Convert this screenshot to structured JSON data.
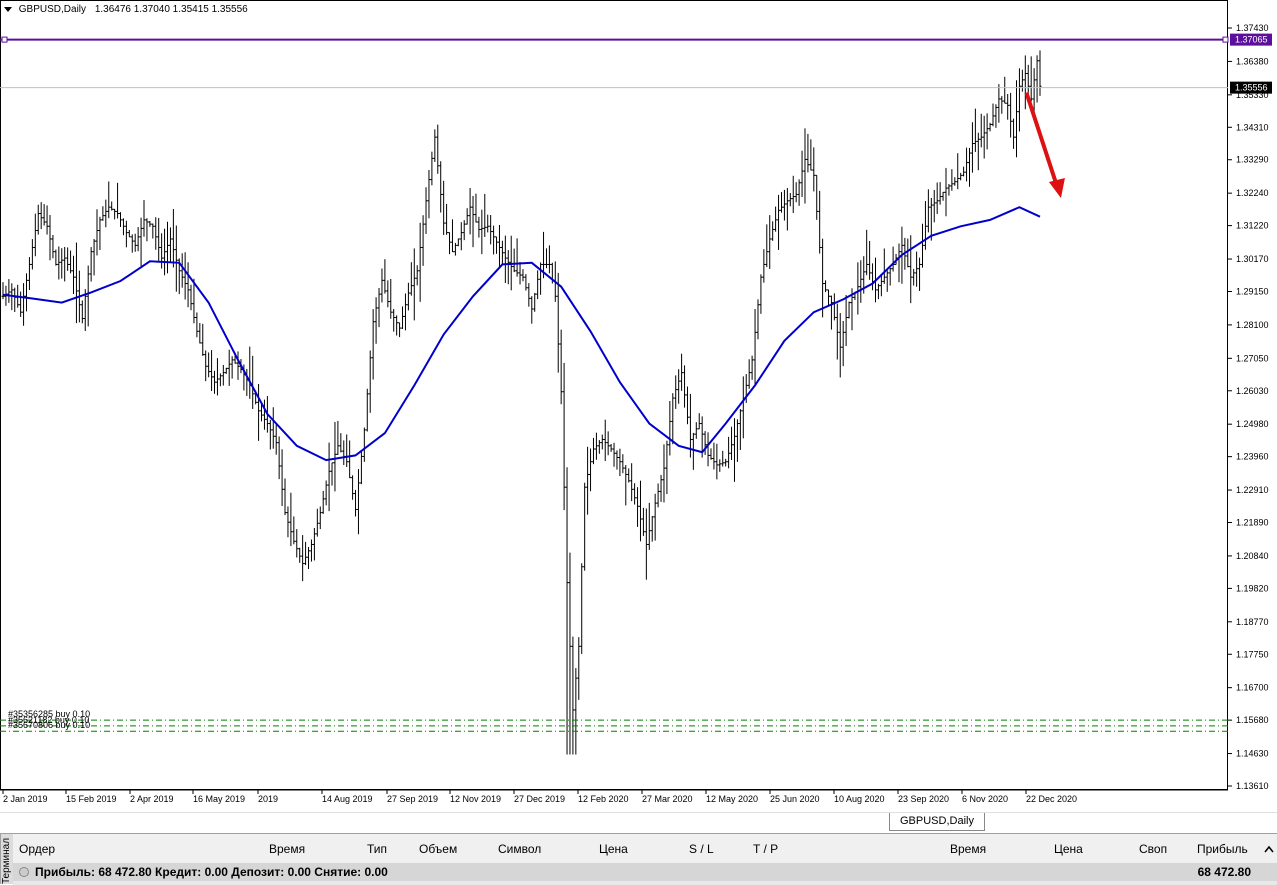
{
  "window": {
    "symbol_label": "GBPUSD,Daily",
    "ohlc": "1.36476 1.37040 1.35415 1.35556"
  },
  "chart_data": {
    "type": "candlestick",
    "symbol": "GBPUSD",
    "timeframe": "Daily",
    "ylim": [
      1.1361,
      1.3774
    ],
    "y_ticks": [
      "1.37430",
      "1.36380",
      "1.35330",
      "1.34310",
      "1.33290",
      "1.32240",
      "1.31220",
      "1.30170",
      "1.29150",
      "1.28100",
      "1.27050",
      "1.26030",
      "1.24980",
      "1.23960",
      "1.22910",
      "1.21890",
      "1.20840",
      "1.19820",
      "1.18770",
      "1.17750",
      "1.16700",
      "1.15680",
      "1.14630",
      "1.13610"
    ],
    "x_ticks": [
      "2 Jan 2019",
      "15 Feb 2019",
      "2 Apr 2019",
      "16 May 2019",
      "2019",
      "14 Aug 2019",
      "27 Sep 2019",
      "12 Nov 2019",
      "27 Dec 2019",
      "12 Feb 2020",
      "27 Mar 2020",
      "12 May 2020",
      "25 Jun 2020",
      "10 Aug 2020",
      "23 Sep 2020",
      "6 Nov 2020",
      "22 Dec 2020"
    ],
    "price_profile": [
      [
        0,
        1.29
      ],
      [
        3,
        1.292
      ],
      [
        6,
        1.285
      ],
      [
        9,
        1.3
      ],
      [
        12,
        1.316
      ],
      [
        15,
        1.312
      ],
      [
        18,
        1.3
      ],
      [
        21,
        1.302
      ],
      [
        24,
        1.296
      ],
      [
        27,
        1.283
      ],
      [
        30,
        1.304
      ],
      [
        33,
        1.314
      ],
      [
        36,
        1.318
      ],
      [
        39,
        1.316
      ],
      [
        42,
        1.31
      ],
      [
        45,
        1.306
      ],
      [
        48,
        1.314
      ],
      [
        51,
        1.312
      ],
      [
        54,
        1.302
      ],
      [
        57,
        1.308
      ],
      [
        60,
        1.298
      ],
      [
        63,
        1.292
      ],
      [
        66,
        1.279
      ],
      [
        69,
        1.268
      ],
      [
        72,
        1.263
      ],
      [
        75,
        1.266
      ],
      [
        78,
        1.27
      ],
      [
        81,
        1.267
      ],
      [
        84,
        1.262
      ],
      [
        87,
        1.254
      ],
      [
        90,
        1.25
      ],
      [
        93,
        1.244
      ],
      [
        96,
        1.222
      ],
      [
        99,
        1.213
      ],
      [
        102,
        1.206
      ],
      [
        105,
        1.212
      ],
      [
        108,
        1.222
      ],
      [
        111,
        1.235
      ],
      [
        114,
        1.243
      ],
      [
        117,
        1.238
      ],
      [
        120,
        1.223
      ],
      [
        123,
        1.248
      ],
      [
        126,
        1.282
      ],
      [
        129,
        1.295
      ],
      [
        132,
        1.285
      ],
      [
        135,
        1.28
      ],
      [
        138,
        1.291
      ],
      [
        141,
        1.298
      ],
      [
        144,
        1.32
      ],
      [
        147,
        1.34
      ],
      [
        150,
        1.313
      ],
      [
        153,
        1.304
      ],
      [
        156,
        1.31
      ],
      [
        159,
        1.318
      ],
      [
        162,
        1.311
      ],
      [
        165,
        1.312
      ],
      [
        168,
        1.307
      ],
      [
        171,
        1.302
      ],
      [
        174,
        1.298
      ],
      [
        177,
        1.296
      ],
      [
        180,
        1.286
      ],
      [
        183,
        1.3
      ],
      [
        186,
        1.3
      ],
      [
        188,
        1.29
      ],
      [
        190,
        1.26
      ],
      [
        192,
        1.2
      ],
      [
        194,
        1.16
      ],
      [
        196,
        1.18
      ],
      [
        198,
        1.23
      ],
      [
        201,
        1.242
      ],
      [
        204,
        1.245
      ],
      [
        207,
        1.242
      ],
      [
        210,
        1.238
      ],
      [
        213,
        1.232
      ],
      [
        216,
        1.224
      ],
      [
        219,
        1.212
      ],
      [
        222,
        1.225
      ],
      [
        225,
        1.236
      ],
      [
        228,
        1.258
      ],
      [
        231,
        1.266
      ],
      [
        234,
        1.245
      ],
      [
        237,
        1.25
      ],
      [
        240,
        1.24
      ],
      [
        243,
        1.237
      ],
      [
        246,
        1.238
      ],
      [
        249,
        1.246
      ],
      [
        252,
        1.258
      ],
      [
        255,
        1.27
      ],
      [
        258,
        1.296
      ],
      [
        261,
        1.308
      ],
      [
        264,
        1.317
      ],
      [
        267,
        1.32
      ],
      [
        270,
        1.322
      ],
      [
        273,
        1.333
      ],
      [
        276,
        1.328
      ],
      [
        279,
        1.294
      ],
      [
        282,
        1.288
      ],
      [
        285,
        1.274
      ],
      [
        288,
        1.288
      ],
      [
        291,
        1.293
      ],
      [
        294,
        1.3
      ],
      [
        297,
        1.292
      ],
      [
        300,
        1.296
      ],
      [
        303,
        1.3
      ],
      [
        306,
        1.306
      ],
      [
        309,
        1.296
      ],
      [
        312,
        1.3
      ],
      [
        315,
        1.318
      ],
      [
        318,
        1.32
      ],
      [
        321,
        1.324
      ],
      [
        324,
        1.326
      ],
      [
        327,
        1.329
      ],
      [
        330,
        1.338
      ],
      [
        333,
        1.34
      ],
      [
        336,
        1.344
      ],
      [
        339,
        1.352
      ],
      [
        342,
        1.35
      ],
      [
        344,
        1.34
      ],
      [
        346,
        1.356
      ],
      [
        348,
        1.36
      ],
      [
        350,
        1.352
      ],
      [
        352,
        1.364
      ],
      [
        353,
        1.356
      ]
    ],
    "moving_average": [
      [
        0,
        1.2905
      ],
      [
        10,
        1.2893
      ],
      [
        20,
        1.288
      ],
      [
        30,
        1.2912
      ],
      [
        40,
        1.2948
      ],
      [
        50,
        1.301
      ],
      [
        60,
        1.3005
      ],
      [
        70,
        1.288
      ],
      [
        80,
        1.27
      ],
      [
        90,
        1.253
      ],
      [
        100,
        1.243
      ],
      [
        110,
        1.2385
      ],
      [
        120,
        1.24
      ],
      [
        130,
        1.247
      ],
      [
        140,
        1.262
      ],
      [
        150,
        1.278
      ],
      [
        160,
        1.29
      ],
      [
        170,
        1.3
      ],
      [
        180,
        1.3005
      ],
      [
        190,
        1.293
      ],
      [
        200,
        1.279
      ],
      [
        210,
        1.263
      ],
      [
        220,
        1.25
      ],
      [
        230,
        1.243
      ],
      [
        238,
        1.241
      ],
      [
        246,
        1.25
      ],
      [
        256,
        1.262
      ],
      [
        266,
        1.276
      ],
      [
        276,
        1.285
      ],
      [
        286,
        1.289
      ],
      [
        296,
        1.294
      ],
      [
        306,
        1.303
      ],
      [
        316,
        1.309
      ],
      [
        326,
        1.312
      ],
      [
        336,
        1.314
      ],
      [
        346,
        1.318
      ],
      [
        353,
        1.315
      ]
    ],
    "horizontal_lines": [
      {
        "price": 1.37065,
        "label": "1.37065",
        "color": "#5b0f9c",
        "style": "solid"
      },
      {
        "price": 1.35556,
        "label": "1.35556",
        "color": "#c0c0c0",
        "style": "solid"
      }
    ],
    "order_lines": [
      {
        "label": "#35356285 buy 0.10",
        "price": 1.1568
      },
      {
        "label": "#35621182 buy 0.10",
        "price": 1.155
      },
      {
        "label": "#35670806 buy 0.10",
        "price": 1.1533
      }
    ],
    "annotation_arrow": {
      "from": [
        347,
        1.354
      ],
      "to": [
        354,
        1.3215
      ],
      "color": "#dd1111"
    },
    "colors": {
      "candles": "#000000",
      "ma": "#0000cc",
      "order_line": "#008000"
    }
  },
  "tab_bar": {
    "active_tab": "GBPUSD,Daily"
  },
  "terminal": {
    "side_label": "Терминал",
    "columns": {
      "order": "Ордер",
      "time": "Время",
      "type": "Тип",
      "volume": "Объем",
      "symbol": "Символ",
      "price": "Цена",
      "sl": "S / L",
      "tp": "T / P",
      "time2": "Время",
      "price2": "Цена",
      "swap": "Своп",
      "profit": "Прибыль"
    },
    "summary": "Прибыль: 68 472.80  Кредит: 0.00  Депозит: 0.00  Снятие: 0.00",
    "total_profit": "68 472.80"
  }
}
